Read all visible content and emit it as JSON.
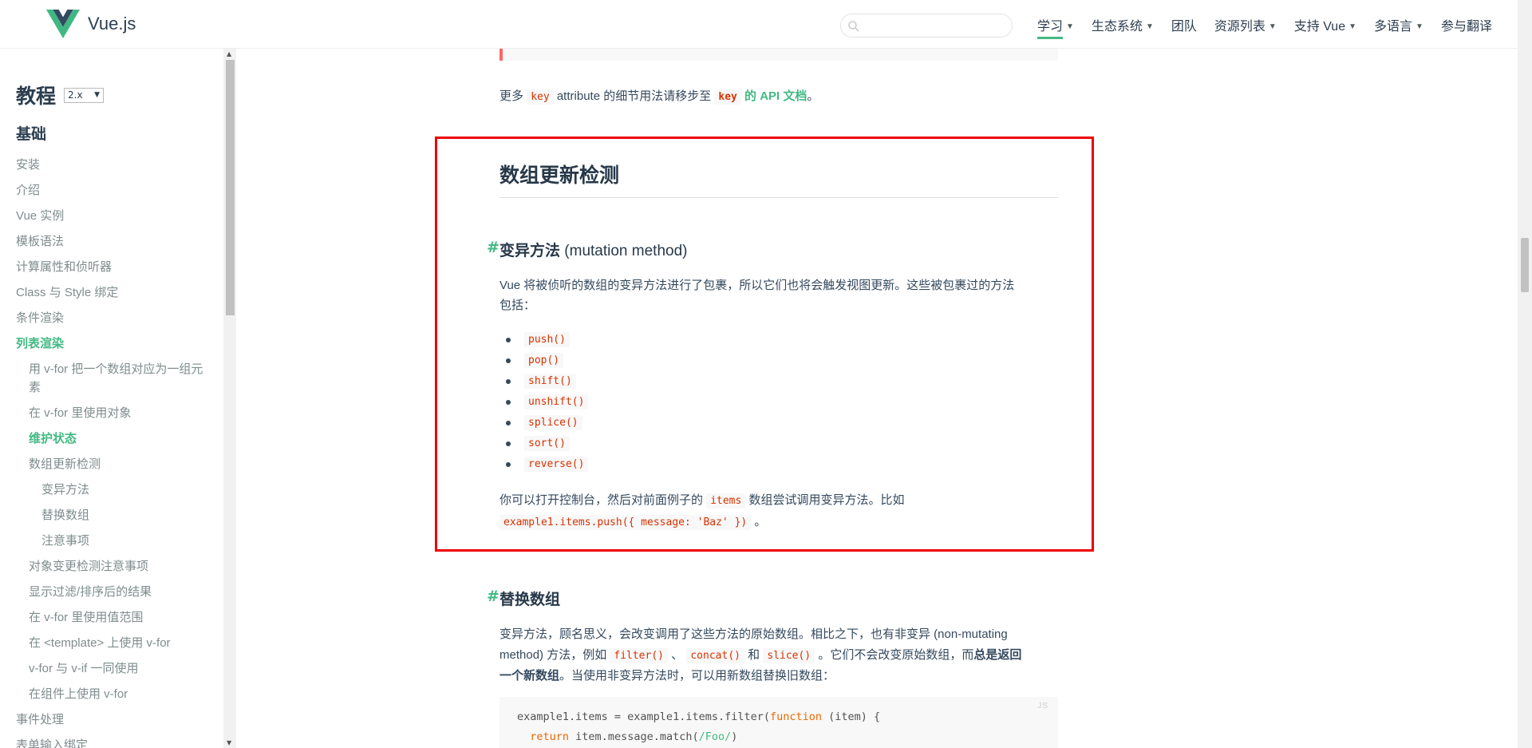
{
  "header": {
    "logo_text": "Vue.js",
    "search_placeholder": "",
    "nav": [
      {
        "label": "学习",
        "dropdown": true,
        "active": true
      },
      {
        "label": "生态系统",
        "dropdown": true
      },
      {
        "label": "团队",
        "dropdown": false
      },
      {
        "label": "资源列表",
        "dropdown": true
      },
      {
        "label": "支持 Vue",
        "dropdown": true
      },
      {
        "label": "多语言",
        "dropdown": true
      },
      {
        "label": "参与翻译",
        "dropdown": false
      }
    ]
  },
  "sidebar": {
    "title": "教程",
    "version": "2.x",
    "section": "基础",
    "items": [
      {
        "label": "安装"
      },
      {
        "label": "介绍"
      },
      {
        "label": "Vue 实例"
      },
      {
        "label": "模板语法"
      },
      {
        "label": "计算属性和侦听器"
      },
      {
        "label": "Class 与 Style 绑定"
      },
      {
        "label": "条件渲染"
      },
      {
        "label": "列表渲染"
      },
      {
        "label": "用 v-for 把一个数组对应为一组元"
      },
      {
        "label": "素"
      },
      {
        "label": "在 v-for 里使用对象"
      },
      {
        "label": "维护状态"
      },
      {
        "label": "数组更新检测"
      },
      {
        "label": "变异方法"
      },
      {
        "label": "替换数组"
      },
      {
        "label": "注意事项"
      },
      {
        "label": "对象变更检测注意事项"
      },
      {
        "label": "显示过滤/排序后的结果"
      },
      {
        "label": "在 v-for 里使用值范围"
      },
      {
        "label": "在 <template> 上使用 v-for"
      },
      {
        "label": "v-for 与 v-if 一同使用"
      },
      {
        "label": "在组件上使用 v-for"
      },
      {
        "label": "事件处理"
      },
      {
        "label": "表单输入绑定"
      }
    ]
  },
  "content": {
    "key_note": {
      "prefix": "更多",
      "code1": "key",
      "middle": "attribute 的细节用法请移步至",
      "code2": "key",
      "link": "的 API 文档",
      "suffix": "。"
    },
    "section_title": "数组更新检测",
    "mutation": {
      "hash": "#",
      "title_bold": "变异方法",
      "title_light": "(mutation method)",
      "desc_line1": "Vue 将被侦听的数组的变异方法进行了包裹，所以它们也将会触发视图更新。这些被包裹过的方法",
      "desc_line2": "包括：",
      "methods": [
        "push()",
        "pop()",
        "shift()",
        "unshift()",
        "splice()",
        "sort()",
        "reverse()"
      ],
      "try_prefix": "你可以打开控制台，然后对前面例子的",
      "try_code1": "items",
      "try_middle": "数组尝试调用变异方法。比如",
      "try_code2": "example1.items.push({ message: 'Baz' })",
      "try_suffix": "。"
    },
    "replace": {
      "hash": "#",
      "title": "替换数组",
      "l1": "变异方法，顾名思义，会改变调用了这些方法的原始数组。相比之下，也有非变异 (non-mutating",
      "l2_a": "method) 方法，例如",
      "l2_c1": "filter()",
      "l2_sep1": "、",
      "l2_c2": "concat()",
      "l2_and": "和",
      "l2_c3": "slice()",
      "l2_b": "。它们不会改变原始数组，而",
      "l2_bold": "总是返回",
      "l3_bold": "一个新数组",
      "l3_rest": "。当使用非变异方法时，可以用新数组替换旧数组："
    },
    "code": {
      "lang": "JS",
      "line1_a": "example1.items = example1.items.filter(",
      "line1_kw": "function",
      "line1_b": " (item) {",
      "line2_kw": "return",
      "line2_a": " item.message.match(",
      "line2_str": "/Foo/",
      "line2_b": ")"
    }
  },
  "colors": {
    "accent": "#42b983",
    "highlight_box": "#e00000",
    "text": "#34495e"
  }
}
